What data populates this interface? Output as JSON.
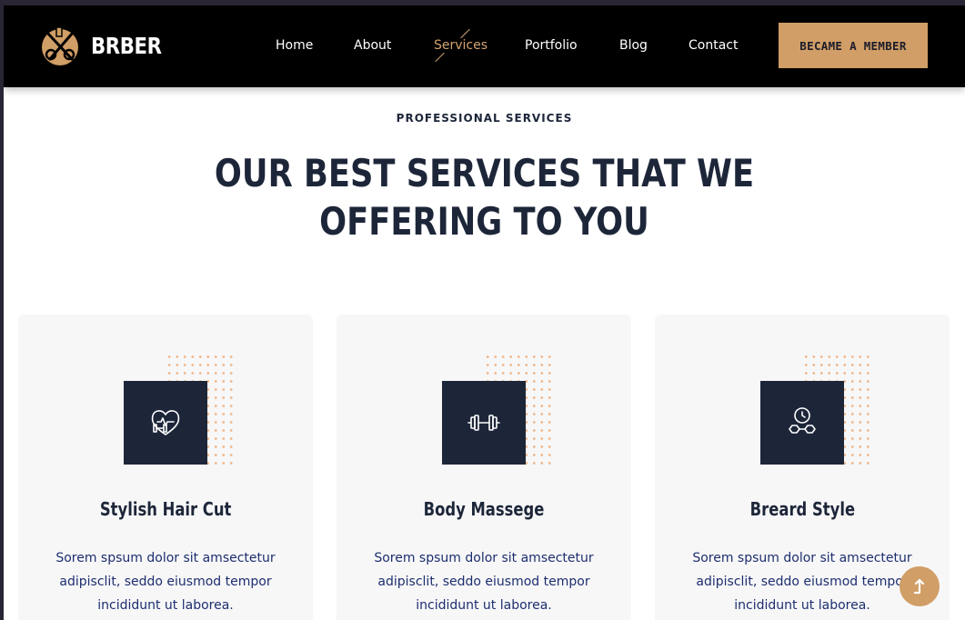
{
  "brand": {
    "name": "BRBER"
  },
  "nav": {
    "items": [
      {
        "label": "Home"
      },
      {
        "label": "About"
      },
      {
        "label": "Services",
        "active": true
      },
      {
        "label": "Portfolio"
      },
      {
        "label": "Blog"
      },
      {
        "label": "Contact"
      }
    ],
    "cta_label": "BECAME A MEMBER"
  },
  "hero": {
    "eyebrow": "PROFESSIONAL SERVICES",
    "headline_line1": "OUR BEST SERVICES THAT WE",
    "headline_line2": "OFFERING TO YOU"
  },
  "services": [
    {
      "title": "Stylish Hair Cut",
      "icon": "heart-dumbbell-icon",
      "description": "Sorem spsum dolor sit amsectetur adipisclit, seddo eiusmod tempor incididunt ut laborea."
    },
    {
      "title": "Body Massege",
      "icon": "dumbbell-icon",
      "description": "Sorem spsum dolor sit amsectetur adipisclit, seddo eiusmod tempor incididunt ut laborea."
    },
    {
      "title": "Breard Style",
      "icon": "clock-dumbbell-icon",
      "description": "Sorem spsum dolor sit amsectetur adipisclit, seddo eiusmod tempor incididunt ut laborea."
    }
  ],
  "colors": {
    "accent": "#d09e66",
    "navy": "#1d2639",
    "navbar": "#000000",
    "card_bg": "#f7f7f8",
    "dots": "#f0b78a"
  }
}
